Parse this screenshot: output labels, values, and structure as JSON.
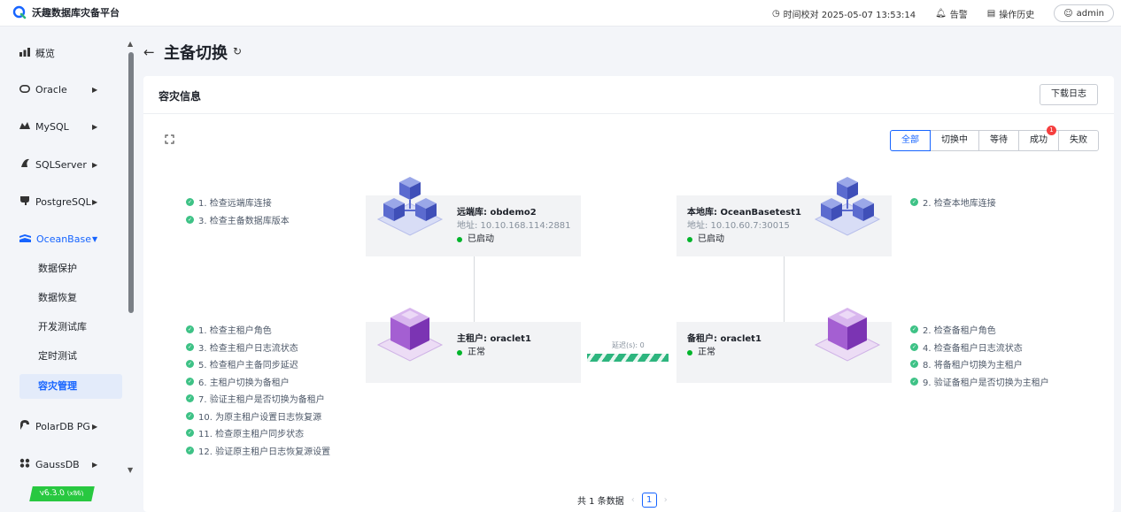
{
  "app": {
    "title": "沃趣数据库灾备平台"
  },
  "topbar": {
    "time_label": "时间校对 2025-05-07 13:53:14",
    "alert_label": "告警",
    "history_label": "操作历史",
    "user_label": "admin"
  },
  "sidebar": {
    "items": [
      {
        "label": "概览"
      },
      {
        "label": "Oracle"
      },
      {
        "label": "MySQL"
      },
      {
        "label": "SQLServer"
      },
      {
        "label": "PostgreSQL"
      },
      {
        "label": "OceanBase"
      },
      {
        "label": "PolarDB PG"
      },
      {
        "label": "GaussDB"
      }
    ],
    "sub_items": [
      {
        "label": "数据保护"
      },
      {
        "label": "数据恢复"
      },
      {
        "label": "开发测试库"
      },
      {
        "label": "定时测试"
      },
      {
        "label": "容灾管理"
      }
    ],
    "version": "v6.3.0",
    "version_arch": "(x86)"
  },
  "page": {
    "title": "主备切换"
  },
  "card": {
    "title": "容灾信息",
    "download_label": "下载日志",
    "filters": [
      {
        "label": "全部"
      },
      {
        "label": "切换中"
      },
      {
        "label": "等待"
      },
      {
        "label": "成功",
        "badge": "1"
      },
      {
        "label": "失败"
      }
    ]
  },
  "steps": {
    "remote_db": [
      "1. 检查远端库连接",
      "3. 检查主备数据库版本"
    ],
    "local_db": [
      "2. 检查本地库连接"
    ],
    "primary_tenant": [
      "1. 检查主租户角色",
      "3. 检查主租户日志流状态",
      "5. 检查租户主备同步延迟",
      "6. 主租户切换为备租户",
      "7. 验证主租户是否切换为备租户",
      "10. 为原主租户设置日志恢复源",
      "11. 检查原主租户同步状态",
      "12. 验证原主租户日志恢复源设置"
    ],
    "standby_tenant": [
      "2. 检查备租户角色",
      "4. 检查备租户日志流状态",
      "8. 将备租户切换为主租户",
      "9. 验证备租户是否切换为主租户"
    ]
  },
  "nodes": {
    "remote": {
      "name": "远端库: obdemo2",
      "addr": "地址: 10.10.168.114:2881",
      "status": "已启动"
    },
    "local": {
      "name": "本地库: OceanBasetest1",
      "addr": "地址: 10.10.60.7:30015",
      "status": "已启动"
    },
    "primary": {
      "name": "主租户: oraclet1",
      "status": "正常"
    },
    "standby": {
      "name": "备租户: oraclet1",
      "status": "正常"
    }
  },
  "delay_label": "延迟(s): 0",
  "pager": {
    "total_label": "共 1 条数据",
    "page": "1"
  },
  "colors": {
    "accent": "#1664ff",
    "success": "#3ec286",
    "badge": "#f53f3f"
  }
}
